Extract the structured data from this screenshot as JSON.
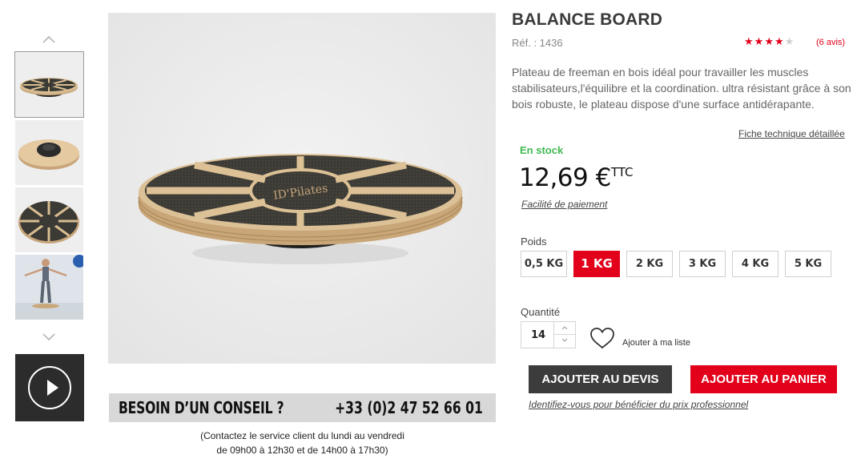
{
  "gallery": {
    "up_icon": "chevron-up-icon",
    "down_icon": "chevron-down-icon",
    "thumbnails": [
      "balance-board-top",
      "balance-board-bottom",
      "balance-board-plan",
      "balance-board-usage"
    ],
    "selected_index": 0,
    "video_icon": "play-icon"
  },
  "main_image": {
    "logo_text": "ID'Pilates"
  },
  "conseil": {
    "title": "BESOIN D’UN CONSEIL ?",
    "phone": "+33 (0)2 47 52 66 01",
    "hours_line1": "(Contactez le service client du lundi au vendredi",
    "hours_line2": "de 09h00 à 12h30 et de 14h00 à 17h30)"
  },
  "product": {
    "title": "BALANCE BOARD",
    "ref": "Réf. : 1436",
    "rating": 4,
    "rating_max": 5,
    "reviews": "(6 avis)",
    "description": "Plateau de freeman en bois idéal pour travailler les muscles stabilisateurs,l'équilibre et la coordination. ultra résistant grâce à son bois robuste, le plateau dispose d'une surface antidérapante.",
    "fiche_link": "Fiche technique détaillée",
    "stock": "En stock",
    "price": "12,69 €",
    "price_suffix": "TTC",
    "facilite": "Facilité de paiement"
  },
  "options": {
    "weight_label": "Poids",
    "weights": [
      "0,5 KG",
      "1 KG",
      "2 KG",
      "3 KG",
      "4 KG",
      "5 KG"
    ],
    "selected_weight": "1 KG"
  },
  "quantity": {
    "label": "Quantité",
    "value": "14"
  },
  "wishlist": {
    "label": "Ajouter à ma liste",
    "icon": "heart-icon"
  },
  "actions": {
    "devis": "AJOUTER AU DEVIS",
    "panier": "AJOUTER AU PANIER",
    "identify": "Identifiez-vous pour bénéficier du prix professionnel"
  },
  "colors": {
    "accent": "#e2001a",
    "stock": "#3fb950",
    "dark_button": "#3c3c3c"
  }
}
